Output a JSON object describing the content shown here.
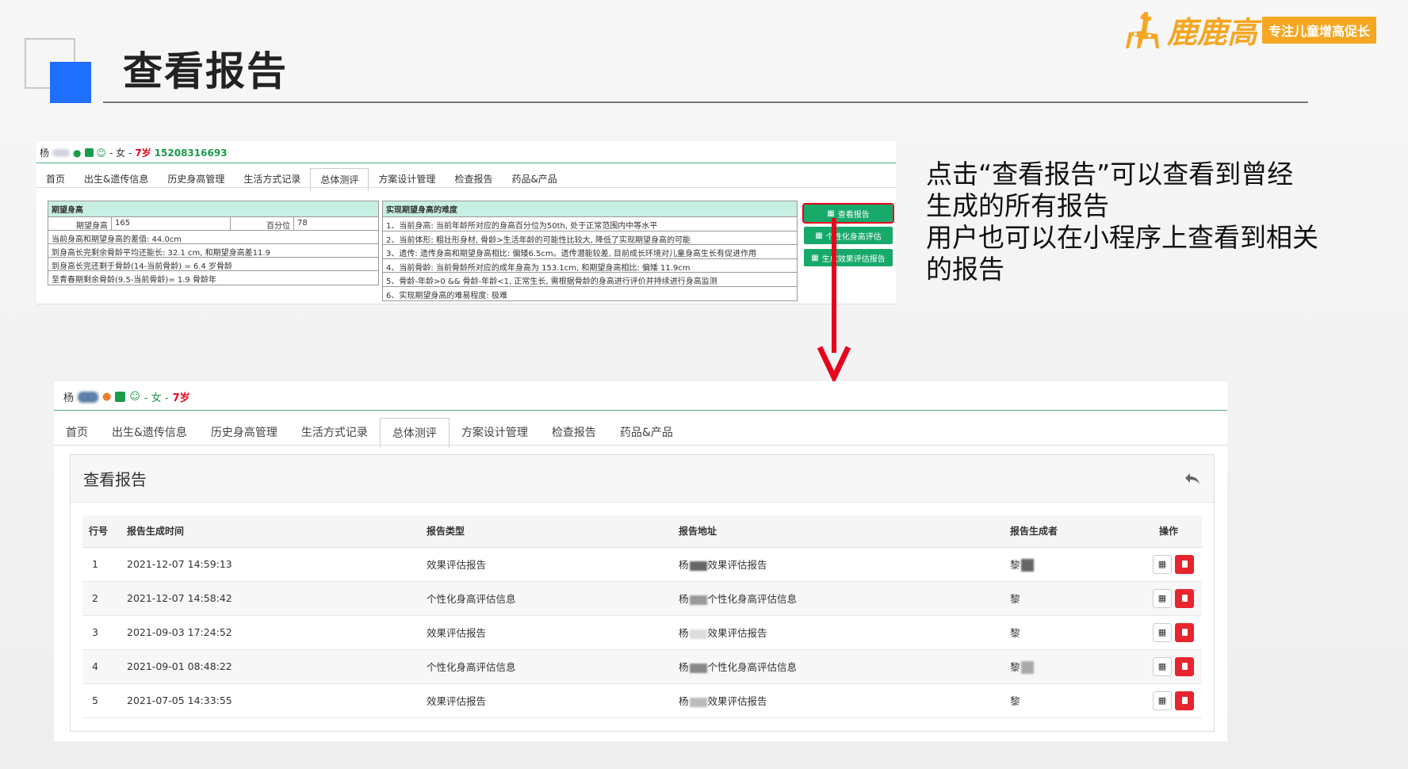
{
  "slide": {
    "title": "查看报告",
    "brand_name": "鹿鹿高",
    "brand_tagline": "专注儿童增高促长",
    "instruction_lines": [
      "点击“查看报告”可以查看到曾经",
      "生成的所有报告",
      "用户也可以在小程序上查看到相关",
      "的报告"
    ]
  },
  "colors": {
    "accent_blue": "#1f6fff",
    "brand_orange": "#f5a623",
    "green": "#17a96a",
    "arrow_red": "#e8001c",
    "danger": "#e8252e"
  },
  "top_panel": {
    "user": {
      "name": "杨",
      "gender_age": "- 女 -",
      "age": "7岁",
      "phone": "15208316693"
    },
    "tabs": [
      "首页",
      "出生&遗传信息",
      "历史身高管理",
      "生活方式记录",
      "总体测评",
      "方案设计管理",
      "检查报告",
      "药品&产品"
    ],
    "active_tab": "总体测评",
    "expected": {
      "header": "期望身高",
      "label_height": "期望身高",
      "value_height": "165",
      "label_pct": "百分位",
      "value_pct": "78",
      "rows": [
        "当前身高和期望身高的差值: 44.0cm",
        "到身高长完剩余骨龄平均还能长: 32.1 cm, 和期望身高差11.9",
        "到身高长完还剩于骨龄(14-当前骨龄) = 6.4 岁骨龄",
        "至青春期剩余骨龄(9.5-当前骨龄)= 1.9 骨龄年"
      ]
    },
    "difficulty": {
      "header": "实现期望身高的难度",
      "rows": [
        "1、当前身高: 当前年龄所对应的身高百分位为50th, 处于正常范围内中等水平",
        "2、当前体形: 粗壮形身材, 骨龄>生活年龄的可能性比较大, 降低了实现期望身高的可能",
        "3、遗传: 遗传身高和期望身高相比: 偏矮6.5cm。遗传潜能较差, 目前成长环境对儿童身高生长有促进作用",
        "4、当前骨龄: 当前骨龄所对应的成年身高为 153.1cm, 和期望身高相比: 偏矮 11.9cm",
        "5、骨龄-年龄>0 && 骨龄-年龄<1, 正常生长, 需根据骨龄的身高进行评价并持续进行身高监测",
        "6、实现期望身高的难易程度: 极难"
      ]
    },
    "buttons": [
      "查看报告",
      "个性化身高评估",
      "生成效果评估报告"
    ]
  },
  "bottom_panel": {
    "user": {
      "name": "杨",
      "gender_age": "- 女 -",
      "age": "7岁"
    },
    "tabs": [
      "首页",
      "出生&遗传信息",
      "历史身高管理",
      "生活方式记录",
      "总体测评",
      "方案设计管理",
      "检查报告",
      "药品&产品"
    ],
    "active_tab": "总体测评",
    "card_title": "查看报告",
    "table": {
      "headers": [
        "行号",
        "报告生成时间",
        "报告类型",
        "报告地址",
        "报告生成者",
        "操作"
      ],
      "rows": [
        {
          "no": "1",
          "time": "2021-12-07 14:59:13",
          "type": "效果评估报告",
          "addr_prefix": "杨",
          "addr_suffix": "效果评估报告",
          "creator": "黎"
        },
        {
          "no": "2",
          "time": "2021-12-07 14:58:42",
          "type": "个性化身高评估信息",
          "addr_prefix": "杨",
          "addr_suffix": "个性化身高评估信息",
          "creator": "黎"
        },
        {
          "no": "3",
          "time": "2021-09-03 17:24:52",
          "type": "效果评估报告",
          "addr_prefix": "杨",
          "addr_suffix": "效果评估报告",
          "creator": "黎"
        },
        {
          "no": "4",
          "time": "2021-09-01 08:48:22",
          "type": "个性化身高评估信息",
          "addr_prefix": "杨",
          "addr_suffix": "个性化身高评估信息",
          "creator": "黎"
        },
        {
          "no": "5",
          "time": "2021-07-05 14:33:55",
          "type": "效果评估报告",
          "addr_prefix": "杨",
          "addr_suffix": "效果评估报告",
          "creator": "黎"
        }
      ]
    }
  }
}
